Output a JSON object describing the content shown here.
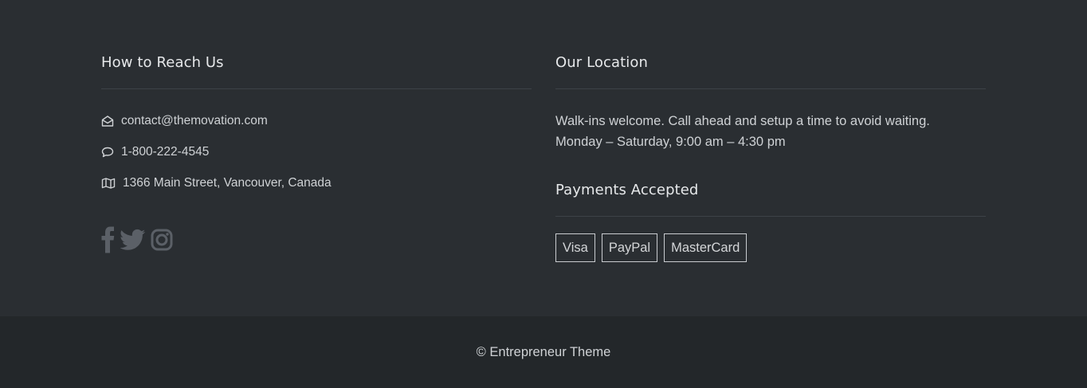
{
  "reach": {
    "heading": "How to Reach Us",
    "email": "contact@themovation.com",
    "phone": "1-800-222-4545",
    "address": "1366 Main Street, Vancouver, Canada",
    "icons": {
      "email": "envelope-open-icon",
      "phone": "speech-bubble-icon",
      "address": "map-icon"
    },
    "social": [
      "facebook-icon",
      "twitter-icon",
      "instagram-icon"
    ]
  },
  "location": {
    "heading": "Our Location",
    "line1": "Walk-ins welcome. Call ahead and setup a time to avoid waiting.",
    "line2": "Monday – Saturday, 9:00 am – 4:30 pm"
  },
  "payments": {
    "heading": "Payments Accepted",
    "methods": [
      "Visa",
      "PayPal",
      "MasterCard"
    ]
  },
  "footer": {
    "copyright": "© Entrepreneur Theme"
  },
  "colors": {
    "background": "#2a2e32",
    "bottom_bar": "#23272a",
    "text": "#cfd2d5",
    "social_icon": "#5b6067"
  }
}
